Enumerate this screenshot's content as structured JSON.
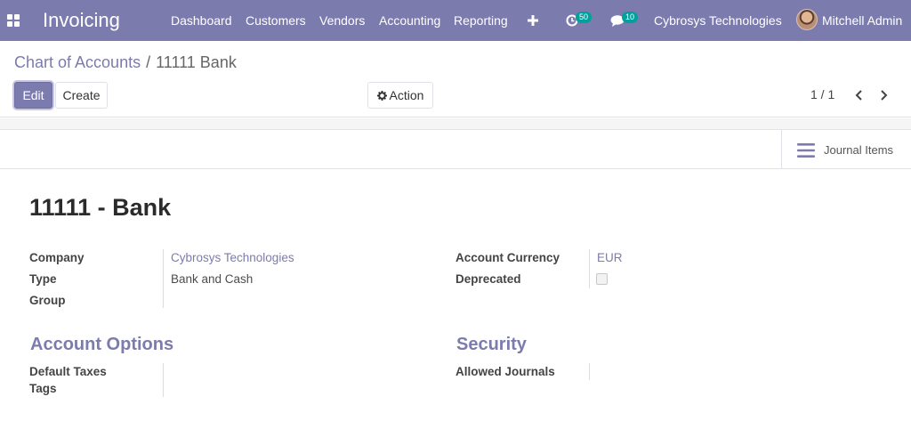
{
  "navbar": {
    "app_name": "Invoicing",
    "menu": {
      "dashboard": "Dashboard",
      "customers": "Customers",
      "vendors": "Vendors",
      "accounting": "Accounting",
      "reporting": "Reporting"
    },
    "activity_count": "50",
    "message_count": "10",
    "company": "Cybrosys Technologies",
    "user": "Mitchell Admin",
    "icons": [
      "apps-grid-icon",
      "plus-icon",
      "activity-clock-icon",
      "chat-icon",
      "user-avatar"
    ],
    "color": "#7c7bad",
    "badge_color": "#00a09d"
  },
  "breadcrumb": {
    "parent": "Chart of Accounts",
    "separator": "/",
    "current": "11111 Bank"
  },
  "buttons": {
    "edit": "Edit",
    "create": "Create",
    "action": "Action"
  },
  "pager": {
    "value": "1 / 1"
  },
  "smart_button": {
    "journal_items": "Journal Items"
  },
  "form": {
    "title": "11111 - Bank",
    "fields_left": {
      "company_label": "Company",
      "company_value": "Cybrosys Technologies",
      "type_label": "Type",
      "type_value": "Bank and Cash",
      "group_label": "Group"
    },
    "fields_right": {
      "currency_label": "Account Currency",
      "currency_value": "EUR",
      "deprecated_label": "Deprecated",
      "deprecated_checked": false
    },
    "account_options": {
      "title": "Account Options",
      "default_taxes_label": "Default Taxes",
      "tags_label": "Tags"
    },
    "security": {
      "title": "Security",
      "allowed_journals_label": "Allowed Journals"
    }
  }
}
